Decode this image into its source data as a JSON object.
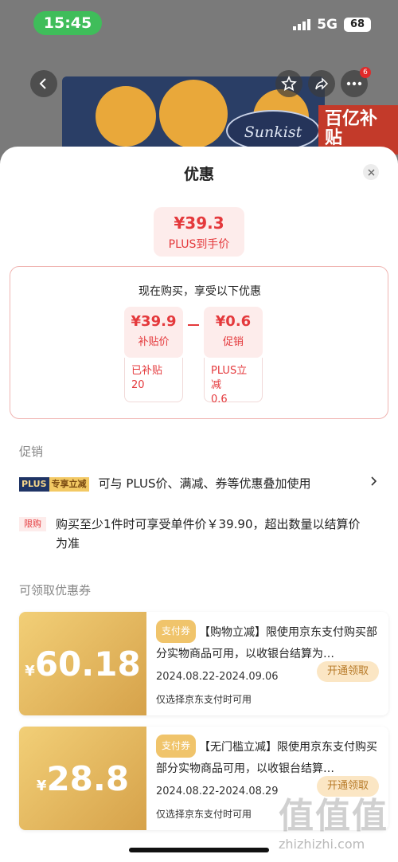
{
  "status_bar": {
    "time": "15:45",
    "network": "5G",
    "battery": "68"
  },
  "background": {
    "brand_logo": "Sunkist",
    "badge_text": "百亿补贴",
    "notification_count": "6"
  },
  "sheet": {
    "title": "优惠",
    "final_price": {
      "amount": "¥39.3",
      "label": "PLUS到手价"
    },
    "breakdown": {
      "heading": "现在购买，享受以下优惠",
      "items": [
        {
          "amount": "¥39.9",
          "label": "补贴价",
          "detail_line1": "已补贴",
          "detail_line2": "20"
        },
        {
          "amount": "¥0.6",
          "label": "促销",
          "detail_line1": "PLUS立减",
          "detail_line2": "0.6"
        }
      ]
    },
    "promotion_section": {
      "label": "促销",
      "plus_tag_left": "PLUS",
      "plus_tag_right": "专享立减",
      "plus_text": "可与 PLUS价、满减、券等优惠叠加使用",
      "limit_tag": "限购",
      "limit_text": "购买至少1件时可享受单件价￥39.90，超出数量以结算价为准"
    },
    "coupon_section": {
      "label": "可领取优惠券",
      "coupons": [
        {
          "currency": "¥",
          "value": "60.18",
          "tag": "支付券",
          "desc": "【购物立减】限使用京东支付购买部分实物商品可用，以收银台结算为…",
          "dates": "2024.08.22-2024.09.06",
          "note": "仅选择京东支付时可用",
          "button": "开通领取"
        },
        {
          "currency": "¥",
          "value": "28.8",
          "tag": "支付券",
          "desc": "【无门槛立减】限使用京东支付购买部分实物商品可用，以收银台结算…",
          "dates": "2024.08.22-2024.08.29",
          "note": "仅选择京东支付时可用",
          "button": "开通领取"
        }
      ]
    }
  },
  "watermark": {
    "glyph": "值值值",
    "text": "zhizhizhi.com"
  },
  "colors": {
    "accent_red": "#e4393c",
    "coupon_gold": "#d6a24a",
    "plus_navy": "#1f3465"
  }
}
